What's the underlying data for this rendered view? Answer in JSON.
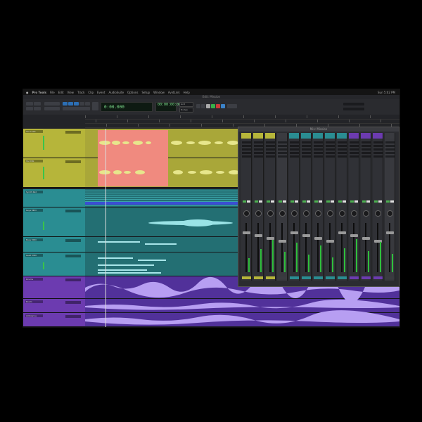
{
  "app": {
    "name": "Pro Tools",
    "menus": [
      "File",
      "Edit",
      "View",
      "Track",
      "Clip",
      "Event",
      "AudioSuite",
      "Options",
      "Setup",
      "Window",
      "AvidLink",
      "Help"
    ],
    "clock": "Sun 5:02 PM"
  },
  "window": {
    "title": "Edit: Mission"
  },
  "toolbar": {
    "main_counter": "0:00.000",
    "sub_counter": "00:00:00:00",
    "grid_label": "Grid",
    "nudge_label": "Nudge"
  },
  "mixer": {
    "title": "Mix: Mission"
  },
  "tracks": [
    {
      "name": "Voc Lead",
      "color": "#b6b53a"
    },
    {
      "name": "Voc Dbl",
      "color": "#b6b53a"
    },
    {
      "name": "Synth Pad",
      "color": "#2a8d92"
    },
    {
      "name": "Keys MIDI",
      "color": "#2a8d92"
    },
    {
      "name": "Bass MIDI",
      "color": "#2a8d92"
    },
    {
      "name": "Lead MIDI",
      "color": "#2a8d92"
    },
    {
      "name": "Drums",
      "color": "#6c3bb0"
    },
    {
      "name": "Room",
      "color": "#6c3bb0"
    },
    {
      "name": "Ambience",
      "color": "#6c3bb0"
    }
  ],
  "colors": {
    "vocal": "#b6b53a",
    "vocal_region": "#a9a739",
    "selection": "#f08a7f",
    "teal": "#2a8d92",
    "teal_lane": "#236f73",
    "purple": "#6c3bb0",
    "purple_lane": "#51319a",
    "wave_yellow": "#e7e68c",
    "wave_teal": "#9ae3e6",
    "wave_purple": "#b79ef2"
  },
  "icons": [
    "apple-icon",
    "play-icon",
    "stop-icon",
    "record-icon",
    "rewind-icon",
    "forward-icon",
    "loop-icon"
  ]
}
